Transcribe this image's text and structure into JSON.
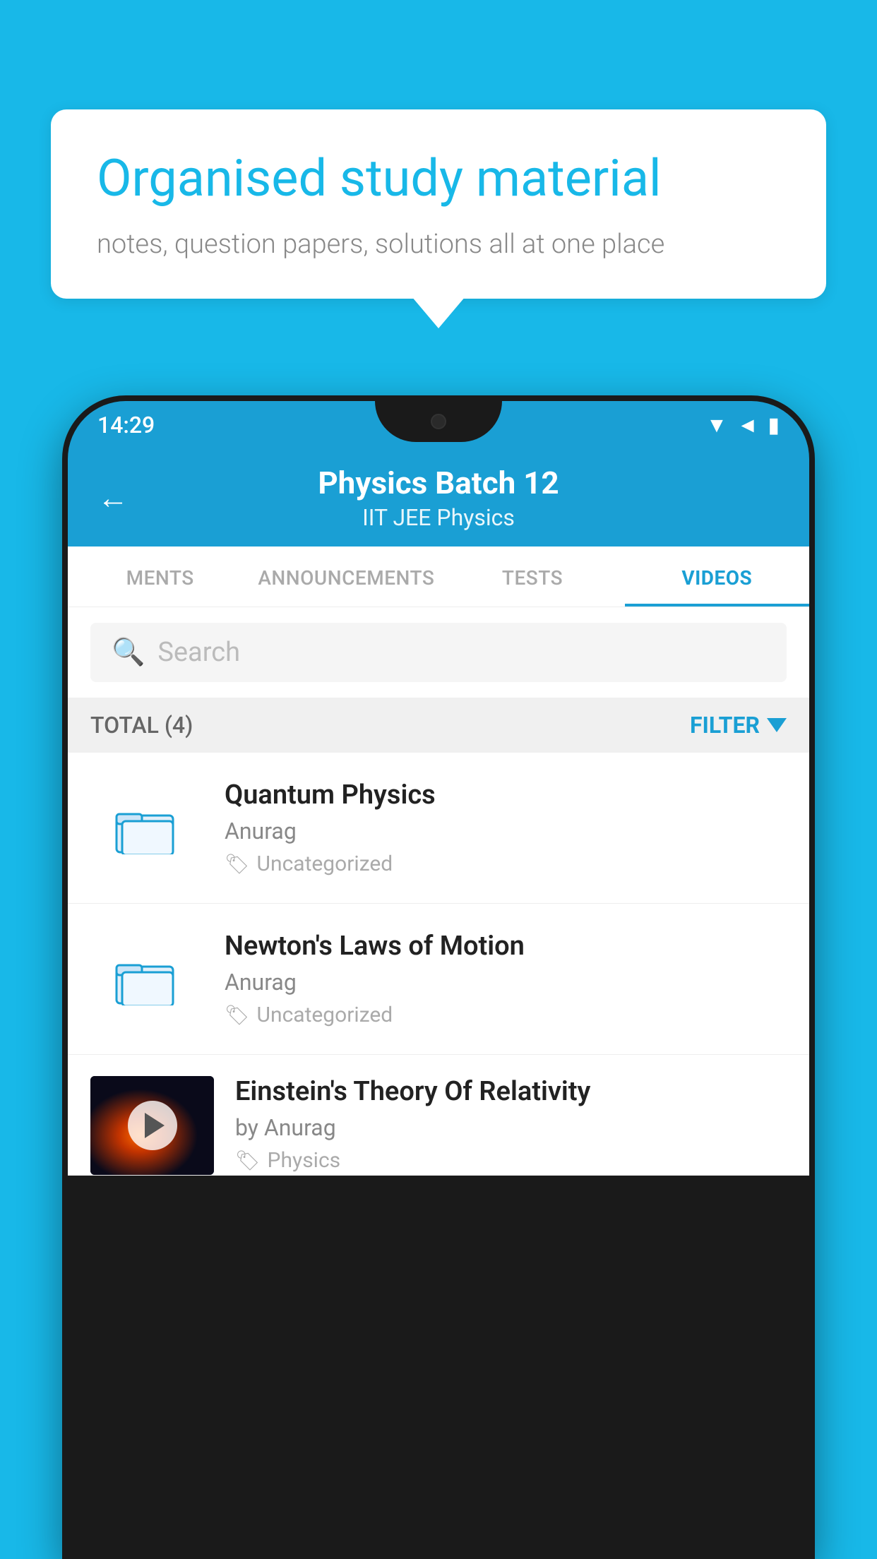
{
  "background_color": "#18b8e8",
  "speech_bubble": {
    "headline": "Organised study material",
    "subtext": "notes, question papers, solutions all at one place"
  },
  "status_bar": {
    "time": "14:29",
    "icons": [
      "wifi",
      "signal",
      "battery"
    ]
  },
  "app_header": {
    "title": "Physics Batch 12",
    "subtitle": "IIT JEE    Physics",
    "back_label": "back"
  },
  "tabs": [
    {
      "label": "MENTS",
      "active": false
    },
    {
      "label": "ANNOUNCEMENTS",
      "active": false
    },
    {
      "label": "TESTS",
      "active": false
    },
    {
      "label": "VIDEOS",
      "active": true
    }
  ],
  "search": {
    "placeholder": "Search"
  },
  "filter_bar": {
    "total_label": "TOTAL (4)",
    "filter_label": "FILTER"
  },
  "videos": [
    {
      "title": "Quantum Physics",
      "author": "Anurag",
      "tag": "Uncategorized",
      "type": "folder"
    },
    {
      "title": "Newton's Laws of Motion",
      "author": "Anurag",
      "tag": "Uncategorized",
      "type": "folder"
    },
    {
      "title": "Einstein's Theory Of Relativity",
      "author": "by Anurag",
      "tag": "Physics",
      "type": "video"
    }
  ]
}
